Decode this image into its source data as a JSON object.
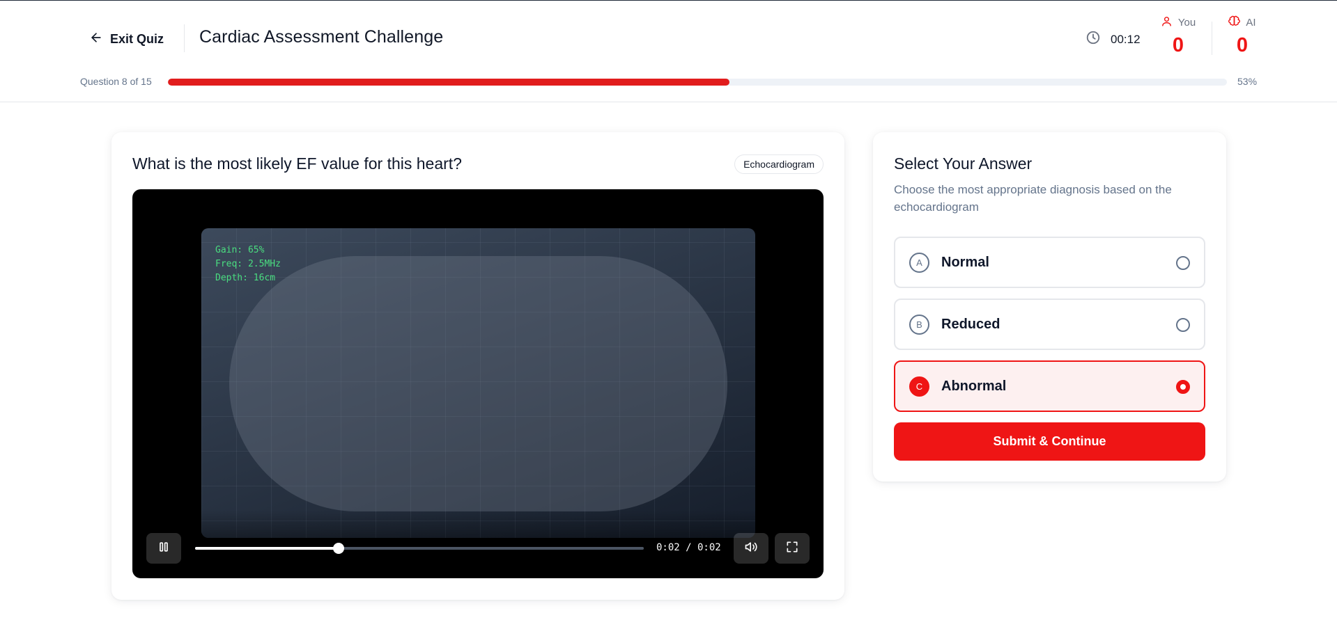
{
  "header": {
    "exit_label": "Exit Quiz",
    "title": "Cardiac Assessment Challenge",
    "timer": "00:12",
    "scores": {
      "you_label": "You",
      "you_value": "0",
      "ai_label": "AI",
      "ai_value": "0"
    }
  },
  "progress": {
    "label": "Question 8 of 15",
    "percent_label": "53%",
    "fraction": 0.53
  },
  "question": {
    "text": "What is the most likely EF value for this heart?",
    "tag": "Echocardiogram"
  },
  "video": {
    "readout": {
      "gain": "Gain: 65%",
      "freq": "Freq: 2.5MHz",
      "depth": "Depth: 16cm"
    },
    "time": "0:02 / 0:02",
    "seek_fraction": 0.32
  },
  "answer": {
    "title": "Select Your Answer",
    "subtitle": "Choose the most appropriate diagnosis based on the echocardiogram",
    "options": [
      {
        "letter": "A",
        "label": "Normal",
        "selected": false
      },
      {
        "letter": "B",
        "label": "Reduced",
        "selected": false
      },
      {
        "letter": "C",
        "label": "Abnormal",
        "selected": true
      }
    ],
    "submit_label": "Submit & Continue"
  },
  "colors": {
    "accent": "#ef1515",
    "progress_fill": "#e11d1d",
    "readout_text": "#4ade80"
  },
  "icons": {
    "exit": "arrow-left-icon",
    "timer": "clock-icon",
    "you": "user-icon",
    "ai": "brain-icon",
    "pause": "pause-icon",
    "volume": "volume-icon",
    "fullscreen": "fullscreen-icon"
  }
}
